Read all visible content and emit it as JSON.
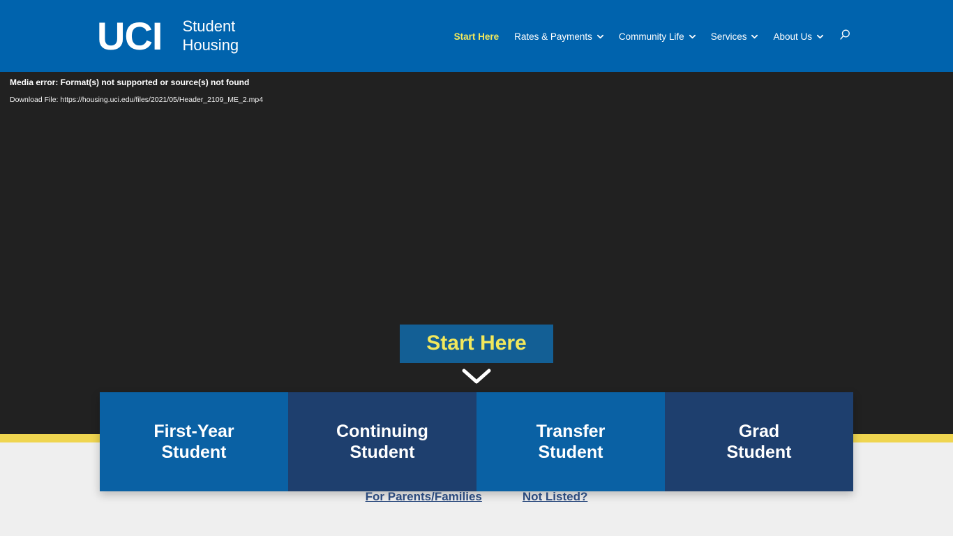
{
  "header": {
    "logo": {
      "mark": "UCI",
      "line1": "Student",
      "line2": "Housing",
      "mark_icon": "uci-logo-icon"
    },
    "nav": [
      {
        "label": "Start Here",
        "active": true,
        "has_dropdown": false
      },
      {
        "label": "Rates & Payments",
        "active": false,
        "has_dropdown": true
      },
      {
        "label": "Community Life",
        "active": false,
        "has_dropdown": true
      },
      {
        "label": "Services",
        "active": false,
        "has_dropdown": true
      },
      {
        "label": "About Us",
        "active": false,
        "has_dropdown": true
      }
    ],
    "search_icon": "search-icon",
    "background_color": "#0063ad",
    "active_color": "#f2e85c"
  },
  "hero": {
    "background_color": "#212121",
    "media_error": "Media error: Format(s) not supported or source(s) not found",
    "download_label": "Download File: https://housing.uci.edu/files/2021/05/Header_2109_ME_2.mp4",
    "start_here_button": "Start Here",
    "start_here_button_color": "#135f95",
    "start_here_text_color": "#f2e85c",
    "down_chevron_icon": "chevron-down-icon"
  },
  "divider": {
    "color": "#efd550"
  },
  "cards": [
    {
      "line1": "First-Year",
      "line2": "Student",
      "color": "#0a61a4",
      "style": "blue"
    },
    {
      "line1": "Continuing",
      "line2": "Student",
      "color": "#1e3f6e",
      "style": "navy"
    },
    {
      "line1": "Transfer",
      "line2": "Student",
      "color": "#0a61a4",
      "style": "blue"
    },
    {
      "line1": "Grad",
      "line2": "Student",
      "color": "#1e3f6e",
      "style": "navy"
    }
  ],
  "bottom_links": [
    {
      "label": "For Parents/Families"
    },
    {
      "label": "Not Listed?"
    }
  ],
  "page": {
    "background_color": "#efefef"
  }
}
